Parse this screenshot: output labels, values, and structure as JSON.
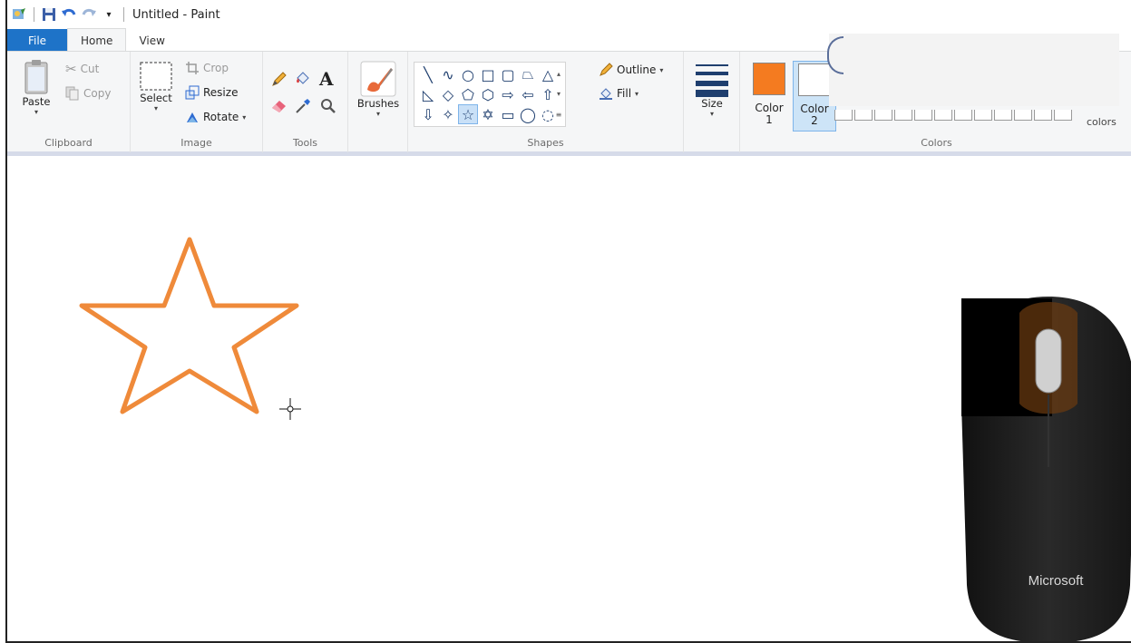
{
  "window": {
    "title": "Untitled - Paint"
  },
  "tabs": [
    {
      "label": "File"
    },
    {
      "label": "Home"
    },
    {
      "label": "View"
    }
  ],
  "clipboard": {
    "paste": "Paste",
    "cut": "Cut",
    "copy": "Copy",
    "group": "Clipboard"
  },
  "image": {
    "select": "Select",
    "crop": "Crop",
    "resize": "Resize",
    "rotate": "Rotate",
    "group": "Image"
  },
  "tools": {
    "group": "Tools"
  },
  "brushes": {
    "label": "Brushes"
  },
  "shapes": {
    "outline": "Outline",
    "fill": "Fill",
    "group": "Shapes"
  },
  "size": {
    "label": "Size"
  },
  "colors": {
    "color1_label": "Color",
    "color1_num": "1",
    "color2_label": "Color",
    "color2_num": "2",
    "edit_partial": "colors",
    "group": "Colors",
    "color1_value": "#f47b20",
    "color2_value": "#ffffff"
  },
  "canvas": {
    "star_color": "#ef8a3a"
  },
  "mouse": {
    "brand": "Microsoft"
  }
}
